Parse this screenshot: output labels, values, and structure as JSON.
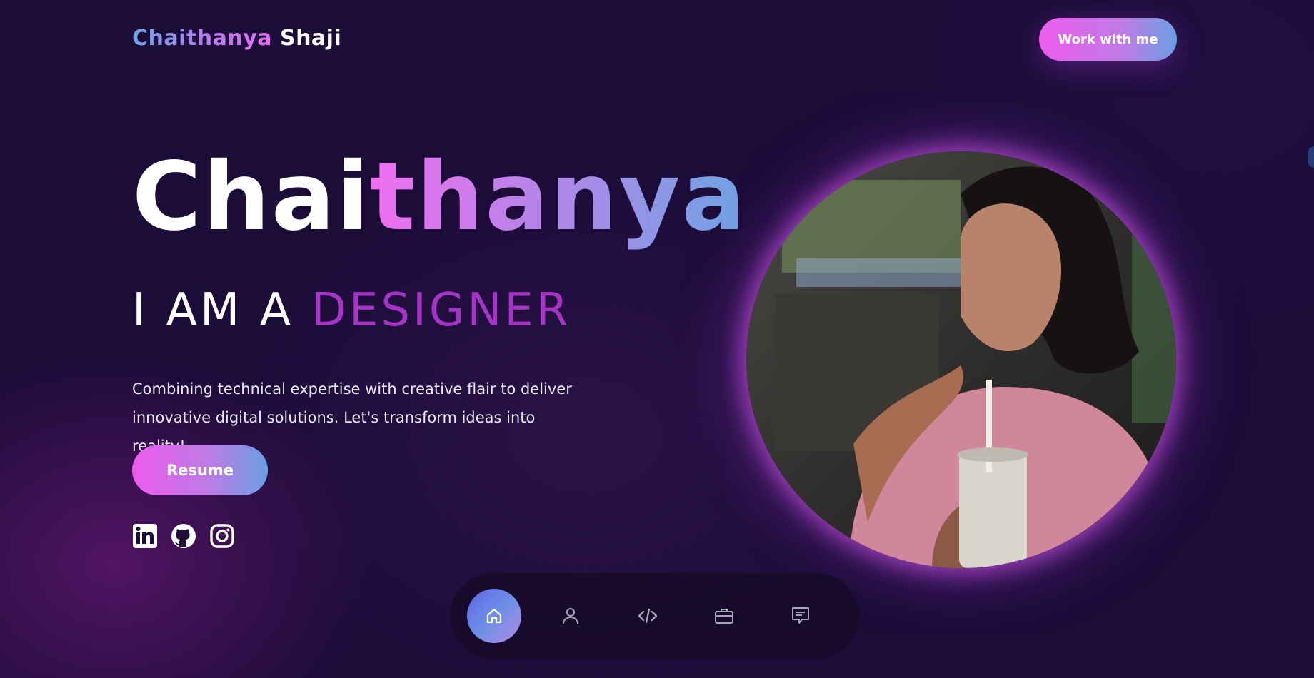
{
  "header": {
    "logo_first": "Chaithanya",
    "logo_last": "Shaji",
    "cta_label": "Work with me"
  },
  "hero": {
    "name_part1": "Chai",
    "name_part2": "thanya",
    "role_prefix": "I AM A",
    "role_word": "DESIGNER",
    "description": "Combining technical expertise with creative flair to deliver innovative digital solutions. Let's transform ideas into reality!",
    "resume_label": "Resume"
  },
  "socials": [
    {
      "icon": "linkedin-icon"
    },
    {
      "icon": "github-icon"
    },
    {
      "icon": "instagram-icon"
    }
  ],
  "dock": {
    "items": [
      {
        "icon": "home-icon",
        "active": true
      },
      {
        "icon": "user-icon",
        "active": false
      },
      {
        "icon": "code-icon",
        "active": false
      },
      {
        "icon": "briefcase-icon",
        "active": false
      },
      {
        "icon": "message-icon",
        "active": false
      }
    ]
  },
  "colors": {
    "background": "#1c0c38",
    "accent_pink": "#ee5cee",
    "accent_blue": "#6a9fe3",
    "role_purple": "#a534c7"
  }
}
